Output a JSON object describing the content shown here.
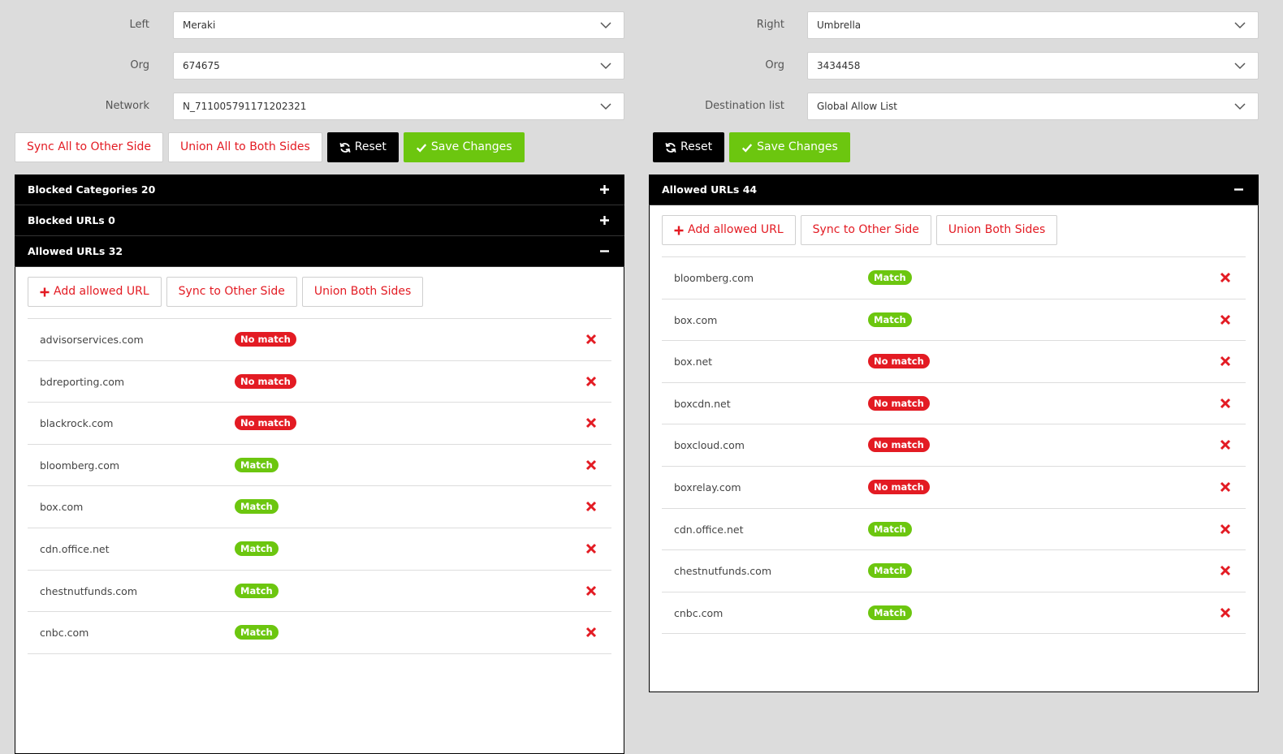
{
  "colors": {
    "accent_red": "#e31b23",
    "match_green": "#6cc60f",
    "header_black": "#000000"
  },
  "left": {
    "fields": [
      {
        "label": "Left",
        "value": "Meraki"
      },
      {
        "label": "Org",
        "value": "674675"
      },
      {
        "label": "Network",
        "value": "N_711005791171202321"
      }
    ],
    "toolbar": {
      "sync_all": "Sync All to Other Side",
      "union_all": "Union All to Both Sides",
      "reset": "Reset",
      "save": "Save Changes"
    },
    "panels": {
      "blocked_categories": "Blocked Categories 20",
      "blocked_urls": "Blocked URLs 0",
      "allowed_urls": "Allowed URLs 32"
    },
    "actions": {
      "add": "Add allowed URL",
      "sync": "Sync to Other Side",
      "union": "Union Both Sides"
    },
    "items": [
      {
        "url": "advisorservices.com",
        "status": "No match",
        "match": false
      },
      {
        "url": "bdreporting.com",
        "status": "No match",
        "match": false
      },
      {
        "url": "blackrock.com",
        "status": "No match",
        "match": false
      },
      {
        "url": "bloomberg.com",
        "status": "Match",
        "match": true
      },
      {
        "url": "box.com",
        "status": "Match",
        "match": true
      },
      {
        "url": "cdn.office.net",
        "status": "Match",
        "match": true
      },
      {
        "url": "chestnutfunds.com",
        "status": "Match",
        "match": true
      },
      {
        "url": "cnbc.com",
        "status": "Match",
        "match": true
      }
    ]
  },
  "right": {
    "fields": [
      {
        "label": "Right",
        "value": "Umbrella"
      },
      {
        "label": "Org",
        "value": "3434458"
      },
      {
        "label": "Destination list",
        "value": "Global Allow List"
      }
    ],
    "toolbar": {
      "reset": "Reset",
      "save": "Save Changes"
    },
    "panels": {
      "allowed_urls": "Allowed URLs 44"
    },
    "actions": {
      "add": "Add allowed URL",
      "sync": "Sync to Other Side",
      "union": "Union Both Sides"
    },
    "items": [
      {
        "url": "bloomberg.com",
        "status": "Match",
        "match": true
      },
      {
        "url": "box.com",
        "status": "Match",
        "match": true
      },
      {
        "url": "box.net",
        "status": "No match",
        "match": false
      },
      {
        "url": "boxcdn.net",
        "status": "No match",
        "match": false
      },
      {
        "url": "boxcloud.com",
        "status": "No match",
        "match": false
      },
      {
        "url": "boxrelay.com",
        "status": "No match",
        "match": false
      },
      {
        "url": "cdn.office.net",
        "status": "Match",
        "match": true
      },
      {
        "url": "chestnutfunds.com",
        "status": "Match",
        "match": true
      },
      {
        "url": "cnbc.com",
        "status": "Match",
        "match": true
      }
    ]
  }
}
